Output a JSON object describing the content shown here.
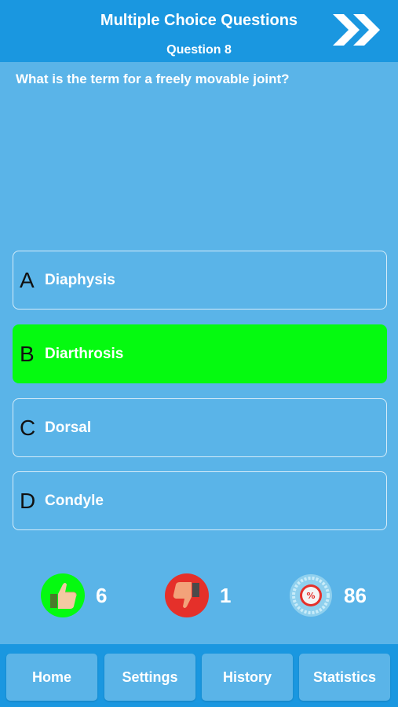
{
  "header": {
    "title": "Multiple Choice Questions",
    "subtitle": "Question 8",
    "next_icon": "double-chevron-right-icon"
  },
  "question": {
    "text": "What is the term for a freely movable joint?"
  },
  "answers": [
    {
      "letter": "A",
      "text": "Diaphysis",
      "state": "normal"
    },
    {
      "letter": "B",
      "text": "Diarthrosis",
      "state": "correct"
    },
    {
      "letter": "C",
      "text": "Dorsal",
      "state": "normal"
    },
    {
      "letter": "D",
      "text": "Condyle",
      "state": "normal"
    }
  ],
  "stats": {
    "correct": {
      "icon": "thumbs-up-icon",
      "value": "6",
      "color": "#05fa10"
    },
    "wrong": {
      "icon": "thumbs-down-icon",
      "value": "1",
      "color": "#e5302a"
    },
    "percent": {
      "icon": "percent-badge-icon",
      "value": "86",
      "color": "#e5302a"
    }
  },
  "nav": {
    "home": "Home",
    "settings": "Settings",
    "history": "History",
    "statistics": "Statistics"
  },
  "colors": {
    "background": "#5ab4e8",
    "header": "#1a97e0",
    "correct_answer": "#05fa10"
  }
}
